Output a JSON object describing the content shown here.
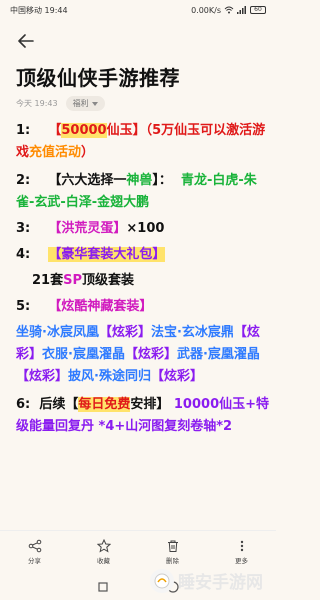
{
  "status": {
    "carrier": "中国移动 19:44",
    "net": "0.00K/s",
    "battery": "60"
  },
  "article": {
    "title": "顶级仙侠手游推荐",
    "date": "今天 19:43",
    "tag": "福利"
  },
  "content": {
    "l1_num": "1:",
    "l1_b1": "【",
    "l1_amount": "50000",
    "l1_b2": "仙玉】（5万仙玉可以激",
    "l1_b3": "活游戏",
    "l1_act": "充值活动",
    "l1_b4": "）",
    "l2_num": "2:",
    "l2_a": "【六大选择一",
    "l2_pet": "神兽",
    "l2_b": "】：",
    "l2_list": "青龙-白虎-朱雀-玄武-白泽-金翅大鹏",
    "l3_num": "3:",
    "l3_item": "【洪荒灵蛋】",
    "l3_qty": "×100",
    "l4_num": "4:",
    "l4_item": "【豪华套装大礼包】",
    "l5_a": "21套",
    "l5_sp": "SP",
    "l5_b": "顶级套装",
    "l6_num": "5:",
    "l6_item": "【炫酷神藏套装】",
    "l7_1": "坐骑·冰宸凤凰",
    "l7_tag": "【炫彩】",
    "l7_2": "法宝·玄冰宸鼎",
    "l7_3": "【炫彩】",
    "l7_4": "衣服·宸凰濯晶",
    "l7_5": "【炫彩】",
    "l7_6": "武器·宸凰濯晶",
    "l7_7": "【炫彩】",
    "l7_8": "披风·殊途同归",
    "l7_9": "【炫彩】",
    "l8_num": "6:",
    "l8_a": "后续【",
    "l8_free": "每日免费",
    "l8_b": "安排】",
    "l8_c": "10000仙玉+特级能量回复丹 *4+山河图复刻卷轴*2"
  },
  "actions": [
    {
      "label": "分享",
      "icon": "share-icon"
    },
    {
      "label": "收藏",
      "icon": "star-icon"
    },
    {
      "label": "删除",
      "icon": "trash-icon"
    },
    {
      "label": "更多",
      "icon": "more-icon"
    }
  ],
  "watermark": "睡安手游网"
}
